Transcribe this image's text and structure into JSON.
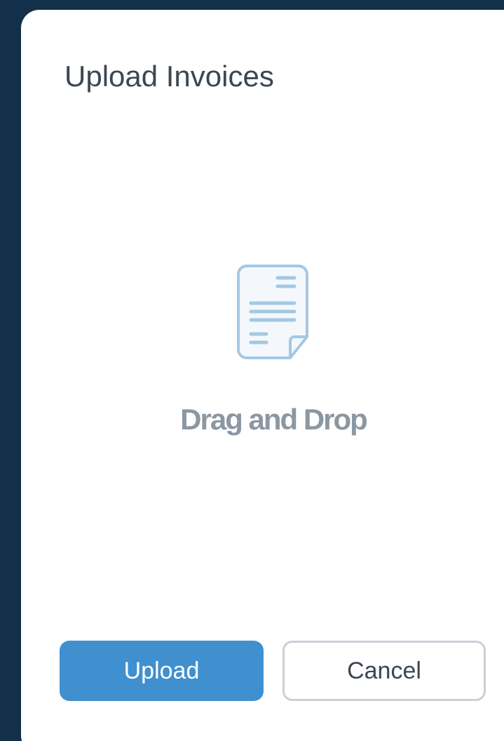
{
  "modal": {
    "title": "Upload Invoices"
  },
  "dropzone": {
    "icon": "document-icon",
    "label": "Drag and Drop"
  },
  "actions": {
    "upload_label": "Upload",
    "cancel_label": "Cancel"
  },
  "colors": {
    "backdrop": "#13304a",
    "primary": "#4090cf",
    "icon": "#a3c8e4",
    "muted_text": "#8b97a3",
    "title_text": "#3b4753",
    "cancel_border": "#c9d0d8"
  }
}
